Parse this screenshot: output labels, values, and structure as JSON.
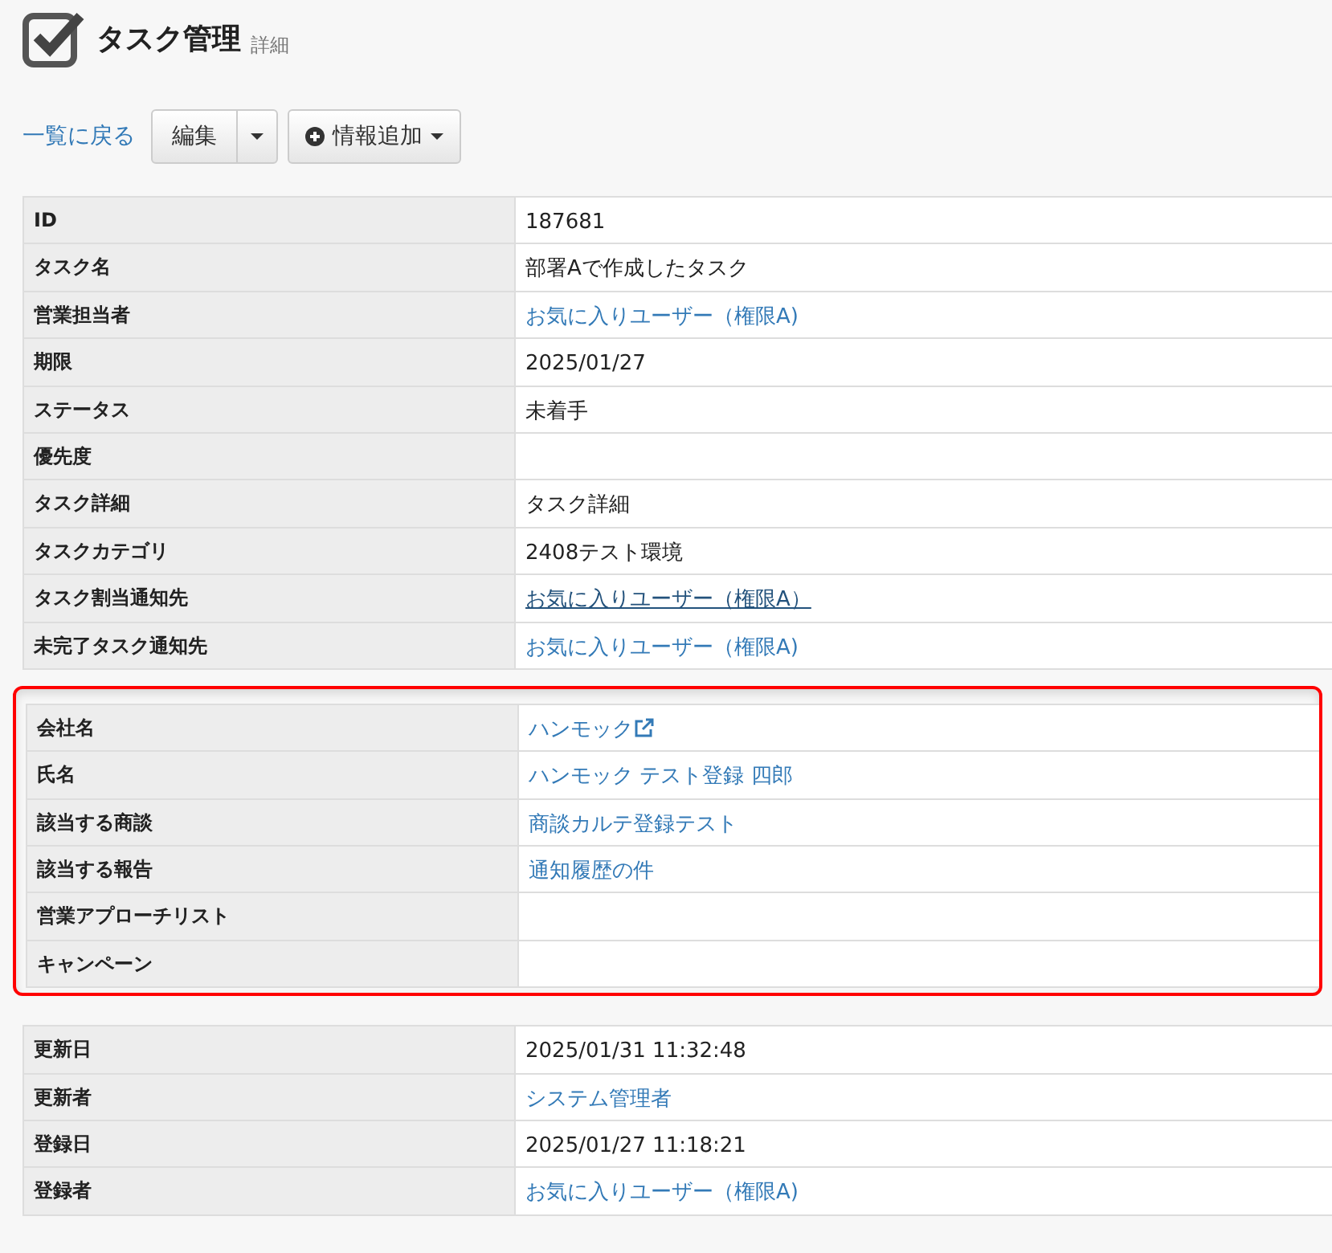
{
  "header": {
    "title": "タスク管理",
    "subtitle": "詳細"
  },
  "toolbar": {
    "back_link": "一覧に戻る",
    "edit_button": "編集",
    "add_button": "情報追加"
  },
  "sections": [
    {
      "highlighted": false,
      "rows": [
        {
          "label": "ID",
          "value": "187681",
          "kind": "text"
        },
        {
          "label": "タスク名",
          "value": "部署Aで作成したタスク",
          "kind": "text"
        },
        {
          "label": "営業担当者",
          "value": "お気に入りユーザー（権限A)",
          "kind": "link"
        },
        {
          "label": "期限",
          "value": "2025/01/27",
          "kind": "text"
        },
        {
          "label": "ステータス",
          "value": "未着手",
          "kind": "text"
        },
        {
          "label": "優先度",
          "kind": "empty"
        },
        {
          "label": "タスク詳細",
          "value": "タスク詳細",
          "kind": "text"
        },
        {
          "label": "タスクカテゴリ",
          "value": "2408テスト環境",
          "kind": "text"
        },
        {
          "label": "タスク割当通知先",
          "value": "お気に入りユーザー（権限A）",
          "kind": "link",
          "hovered": true
        },
        {
          "label": "未完了タスク通知先",
          "value": "お気に入りユーザー（権限A)",
          "kind": "link"
        }
      ]
    },
    {
      "highlighted": true,
      "rows": [
        {
          "label": "会社名",
          "value": "ハンモック",
          "kind": "external_link"
        },
        {
          "label": "氏名",
          "value": "ハンモック テスト登録 四郎",
          "kind": "link"
        },
        {
          "label": "該当する商談",
          "value": "商談カルテ登録テスト",
          "kind": "link"
        },
        {
          "label": "該当する報告",
          "value": "通知履歴の件",
          "kind": "link"
        },
        {
          "label": "営業アプローチリスト",
          "kind": "empty"
        },
        {
          "label": "キャンペーン",
          "kind": "empty"
        }
      ]
    },
    {
      "highlighted": false,
      "rows": [
        {
          "label": "更新日",
          "value": "2025/01/31 11:32:48",
          "kind": "text"
        },
        {
          "label": "更新者",
          "value": "システム管理者",
          "kind": "link"
        },
        {
          "label": "登録日",
          "value": "2025/01/27 11:18:21",
          "kind": "text"
        },
        {
          "label": "登録者",
          "value": "お気に入りユーザー（権限A)",
          "kind": "link"
        }
      ]
    }
  ]
}
